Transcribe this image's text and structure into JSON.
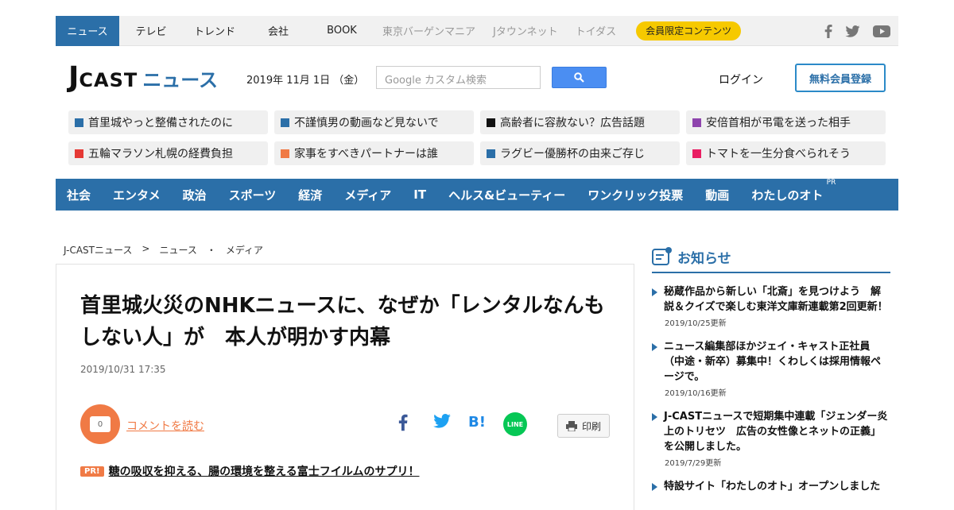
{
  "topnav": {
    "items": [
      "ニュース",
      "テレビ",
      "トレンド",
      "会社",
      "BOOK"
    ],
    "gray_items": [
      "東京バーゲンマニア",
      "Jタウンネット",
      "トイダス"
    ],
    "members_badge": "会員限定コンテンツ"
  },
  "social": [
    "facebook-icon",
    "twitter-icon",
    "youtube-icon"
  ],
  "header": {
    "logo_j": "J",
    "logo_cast": "CAST",
    "logo_news": "ニュース",
    "date": "2019年 11月 1日 （金）",
    "search_placeholder": "Google カスタム検索",
    "login": "ログイン",
    "signup": "無料会員登録"
  },
  "trends": [
    {
      "label": "首里城やっと整備されたのに",
      "color": "#2b6fa8"
    },
    {
      "label": "不謹慎男の動画など見ないで",
      "color": "#2b6fa8"
    },
    {
      "label": "高齢者に容赦ない？広告話題",
      "color": "#111111"
    },
    {
      "label": "安倍首相が弔電を送った相手",
      "color": "#8e44ad"
    },
    {
      "label": "五輪マラソン札幌の経費負担",
      "color": "#e53935"
    },
    {
      "label": "家事をすべきパートナーは誰",
      "color": "#f07a45"
    },
    {
      "label": "ラグビー優勝杯の由来ご存じ",
      "color": "#2b6fa8"
    },
    {
      "label": "トマトを一生分食べられそう",
      "color": "#e91e63"
    }
  ],
  "categories": [
    "社会",
    "エンタメ",
    "政治",
    "スポーツ",
    "経済",
    "メディア",
    "IT",
    "ヘルス&ビューティー",
    "ワンクリック投票",
    "動画",
    "わたしのオト"
  ],
  "categories_pr": "PR",
  "breadcrumb": [
    "J-CASTニュース",
    ">",
    "ニュース",
    "・",
    "メディア"
  ],
  "article": {
    "title": "首里城火災のNHKニュースに、なぜか「レンタルなんもしない人」が　本人が明かす内幕",
    "date": "2019/10/31 17:35",
    "comment_count": "0",
    "comment_link": "コメントを読む",
    "print": "印刷",
    "pr_badge": "PR!",
    "pr_text": "糖の吸収を抑える、腸の環境を整える富士フイルムのサプリ！",
    "line_label": "LINE",
    "hatena_label": "B!"
  },
  "sidebar": {
    "title": "お知らせ",
    "notices": [
      {
        "text": "秘蔵作品から新しい「北斎」を見つけよう　解説＆クイズで楽しむ東洋文庫新連載第2回更新！",
        "date": "2019/10/25更新"
      },
      {
        "text": "ニュース編集部ほかジェイ・キャスト正社員（中途・新卒）募集中！くわしくは採用情報ページで。",
        "date": "2019/10/16更新"
      },
      {
        "text": "J-CASTニュースで短期集中連載「ジェンダー炎上のトリセツ　広告の女性像とネットの正義」を公開しました。",
        "date": "2019/7/29更新"
      },
      {
        "text": "特設サイト「わたしのオト」オープンしました",
        "date": ""
      }
    ]
  }
}
